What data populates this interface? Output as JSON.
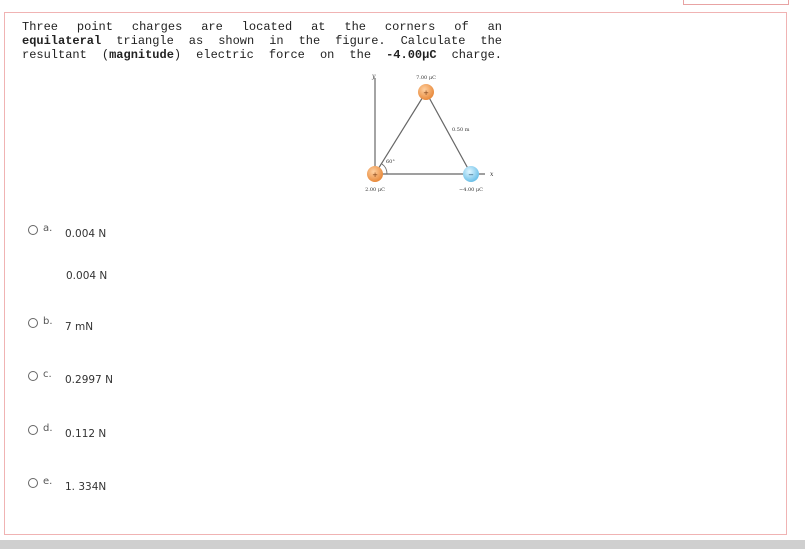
{
  "question": {
    "line1": "Three point charges are located at the corners of an",
    "line2_bold": "equilateral",
    "line2_rest": " triangle as shown in the figure. Calculate the",
    "line3_a": "resultant (",
    "line3_bold1": "magnitude",
    "line3_b": ") electric force on the ",
    "line3_bold2": "-4.00μC",
    "line3_c": " charge."
  },
  "figure": {
    "y_axis_label": "y",
    "x_axis_label": "x",
    "top_charge_label": "7.00 μC",
    "top_charge_sign": "+",
    "left_charge_label": "2.00 μC",
    "left_charge_sign": "+",
    "right_charge_label": "−4.00 μC",
    "right_charge_sign": "−",
    "side_length_label": "0.50 m",
    "angle_label": "60°",
    "colors": {
      "positive": "#f0a060",
      "negative": "#8fd0f0",
      "line": "#666666"
    }
  },
  "options": [
    {
      "letter": "a.",
      "value": "0.004 N"
    },
    {
      "letter": "b.",
      "value": "7 mN"
    },
    {
      "letter": "c.",
      "value": "0.2997 N"
    },
    {
      "letter": "d.",
      "value": "0.112 N"
    },
    {
      "letter": "e.",
      "value": "1. 334N"
    }
  ],
  "option_a_extra": "0.004 N"
}
